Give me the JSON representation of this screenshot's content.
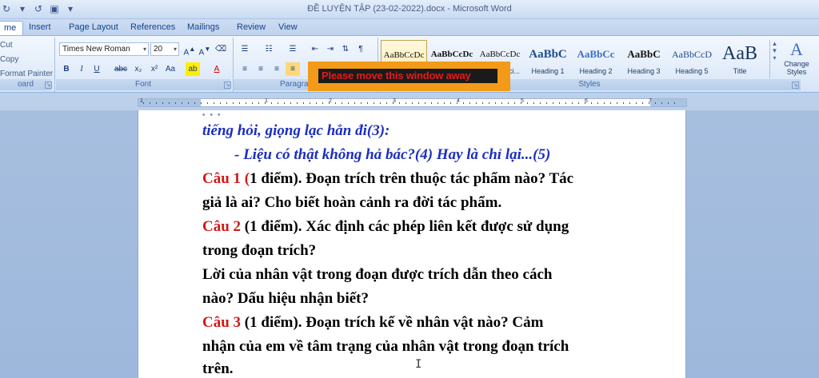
{
  "window": {
    "title": "ĐỀ LUYỆN TẬP (23-02-2022).docx - Microsoft Word"
  },
  "tabs": [
    {
      "label": "me"
    },
    {
      "label": "Insert"
    },
    {
      "label": "Page Layout"
    },
    {
      "label": "References"
    },
    {
      "label": "Mailings"
    },
    {
      "label": "Review"
    },
    {
      "label": "View"
    }
  ],
  "clipboard": {
    "cut": "Cut",
    "copy": "Copy",
    "format_painter": "Format Painter",
    "label": "oard"
  },
  "font": {
    "name": "Times New Roman",
    "size": "20",
    "label": "Font"
  },
  "paragraph": {
    "label": "Paragra"
  },
  "styles": {
    "label": "Styles",
    "change_styles": "Change Styles",
    "items": [
      {
        "preview": "AaBbCcDc",
        "name": ""
      },
      {
        "preview": "AaBbCcDc",
        "name": ""
      },
      {
        "preview": "AaBbCcDc",
        "name": "ci..."
      },
      {
        "preview": "AaBbC",
        "name": "Heading 1"
      },
      {
        "preview": "AaBbCc",
        "name": "Heading 2"
      },
      {
        "preview": "AaBbC",
        "name": "Heading 3"
      },
      {
        "preview": "AaBbCcD",
        "name": "Heading 5"
      },
      {
        "preview": "AaB",
        "name": "Title"
      }
    ]
  },
  "popup": {
    "text": "Please move this window away"
  },
  "ruler": {
    "numbers": [
      "1",
      "1",
      "2",
      "3",
      "4",
      "5",
      "6",
      "7"
    ]
  },
  "document": {
    "lines": {
      "l0": "tiếng hỏi, giọng lạc hẳn đi(3):",
      "l1": "- Liệu có thật không hả bác?(4) Hay là chỉ lại...(5)",
      "q1_label": "Câu 1 (",
      "q1_text": "1 điểm). Đoạn trích trên thuộc tác phẩm nào? Tác",
      "l3": "giả là ai? Cho biết hoàn cảnh ra đời tác phẩm.",
      "q2_label": "Câu 2",
      "q2_text": " (1 điểm). Xác định các phép liên kết được sử dụng",
      "l5": "trong đoạn trích?",
      "l6": "Lời của nhân vật trong đoạn được trích dẫn theo cách",
      "l7": "nào? Dấu hiệu nhận biết?",
      "q3_label": "Câu 3",
      "q3_text": " (1 điểm). Đoạn trích kể về nhân vật nào? Cảm",
      "l9": "nhận của em về tâm trạng của nhân vật trong đoạn trích",
      "l10": "trên."
    }
  },
  "colors": {
    "accent_red": "#d11818",
    "italic_blue": "#1a2ec0",
    "popup_orange": "#f39a18"
  }
}
